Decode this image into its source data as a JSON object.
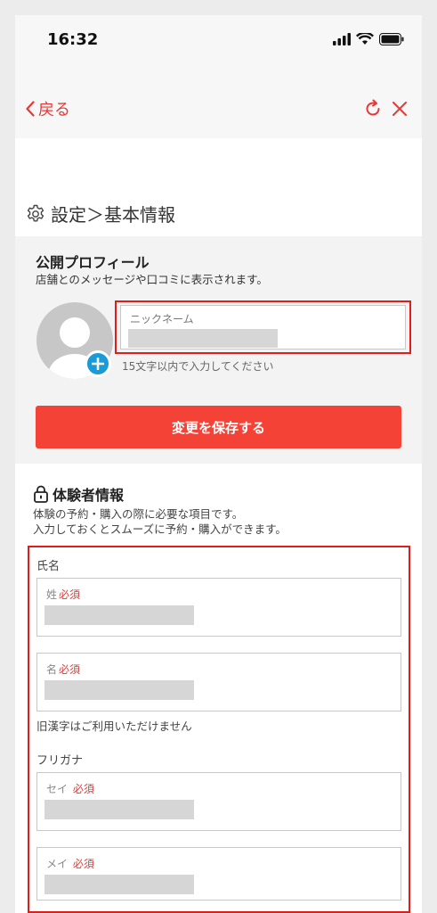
{
  "status_bar": {
    "time": "16:32"
  },
  "nav": {
    "back_label": "戻る"
  },
  "page": {
    "title": "設定＞基本情報"
  },
  "profile": {
    "title": "公開プロフィール",
    "subtitle": "店舗とのメッセージや口コミに表示されます。",
    "nickname_label": "ニックネーム",
    "nickname_hint": "15文字以内で入力してください",
    "save_label": "変更を保存する"
  },
  "experience": {
    "title": "体験者情報",
    "subtitle_line1": "体験の予約・購入の際に必要な項目です。",
    "subtitle_line2": "入力しておくとスムーズに予約・購入ができます。",
    "name_group": "氏名",
    "last_name_label": "姓",
    "first_name_label": "名",
    "required": "必須",
    "kanji_note": "旧漢字はご利用いただけません",
    "kana_group": "フリガナ",
    "last_kana_label": "セイ",
    "first_kana_label": "メイ"
  },
  "colors": {
    "accent": "#e53935",
    "button": "#f44336",
    "highlight": "#e21b1b",
    "avatar_add": "#1a9ad6"
  },
  "icons": [
    "signal-icon",
    "wifi-icon",
    "battery-icon",
    "chevron-left-icon",
    "reload-icon",
    "close-icon",
    "gear-icon",
    "avatar-placeholder-icon",
    "plus-icon",
    "lock-icon"
  ]
}
